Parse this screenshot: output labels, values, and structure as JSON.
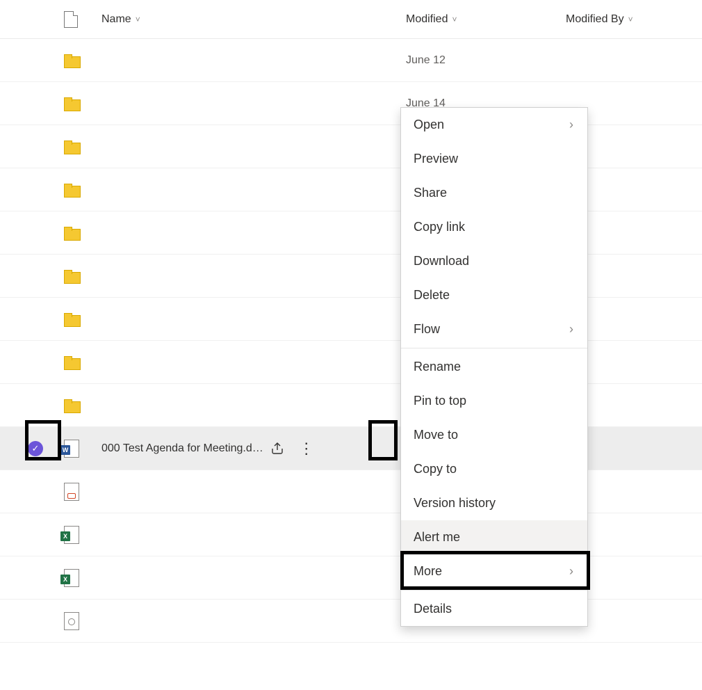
{
  "columns": {
    "name": "Name",
    "modified": "Modified",
    "modifiedBy": "Modified By"
  },
  "rows": [
    {
      "type": "folder",
      "name": "",
      "modified": "June 12"
    },
    {
      "type": "folder",
      "name": "",
      "modified": "June 14"
    },
    {
      "type": "folder",
      "name": "",
      "modified": ""
    },
    {
      "type": "folder",
      "name": "",
      "modified": ""
    },
    {
      "type": "folder",
      "name": "",
      "modified": ""
    },
    {
      "type": "folder",
      "name": "",
      "modified": ""
    },
    {
      "type": "folder",
      "name": "",
      "modified": ""
    },
    {
      "type": "folder",
      "name": "",
      "modified": ""
    },
    {
      "type": "folder",
      "name": "",
      "modified": ""
    },
    {
      "type": "word",
      "name": "000 Test Agenda for Meeting.d…",
      "modified": "",
      "selected": true,
      "showActions": true
    },
    {
      "type": "ppt",
      "name": "",
      "modified": "",
      "syncIssue": true
    },
    {
      "type": "xls",
      "name": "",
      "modified": ""
    },
    {
      "type": "xls",
      "name": "",
      "modified": ""
    },
    {
      "type": "sys",
      "name": "",
      "modified": ""
    }
  ],
  "contextMenu": {
    "open": "Open",
    "preview": "Preview",
    "share": "Share",
    "copyLink": "Copy link",
    "download": "Download",
    "delete": "Delete",
    "flow": "Flow",
    "rename": "Rename",
    "pinToTop": "Pin to top",
    "moveTo": "Move to",
    "copyTo": "Copy to",
    "versionHistory": "Version history",
    "alertMe": "Alert me",
    "more": "More",
    "details": "Details"
  },
  "glyphs": {
    "chevron": "›",
    "caret": "˅",
    "check": "✓",
    "share": "↗",
    "dots": "⋮",
    "sync": "↘"
  }
}
